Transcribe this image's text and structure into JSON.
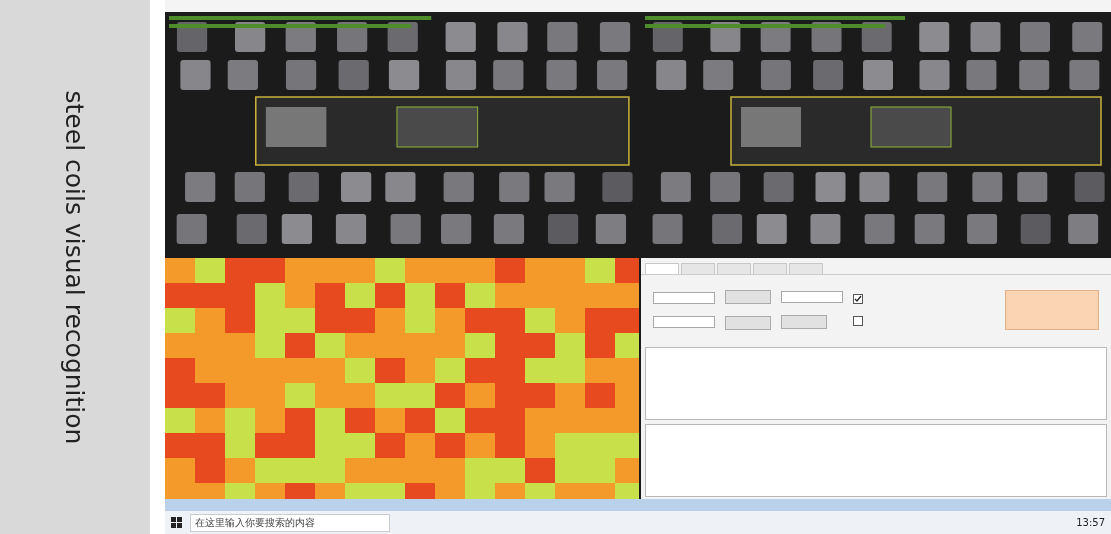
{
  "side_label": "steel coils visual recognition",
  "views": [
    {
      "kind": "camera"
    },
    {
      "kind": "camera"
    },
    {
      "kind": "heatmap"
    }
  ],
  "tabs": [
    {
      "selected": true
    },
    {
      "selected": false
    },
    {
      "selected": false
    },
    {
      "selected": false
    },
    {
      "selected": false
    }
  ],
  "checkboxes": [
    {
      "checked": true
    },
    {
      "checked": false
    }
  ],
  "taskbar": {
    "search": {
      "placeholder": "在这里输入你要搜索的内容"
    },
    "clock": "13:57"
  }
}
